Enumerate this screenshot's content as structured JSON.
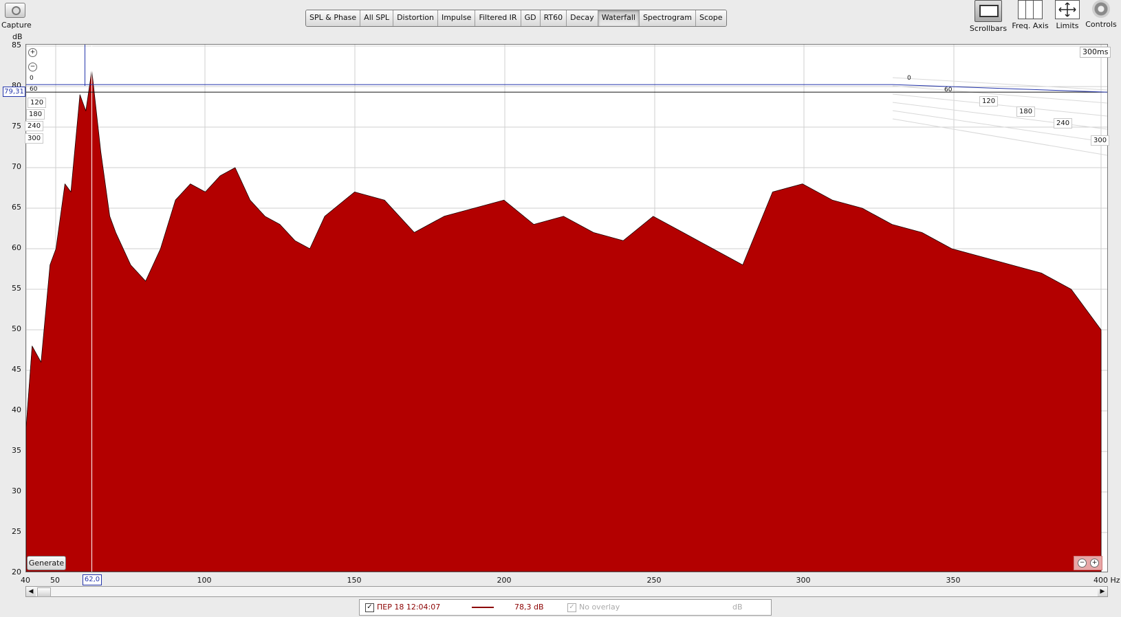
{
  "toolbar": {
    "capture_label": "Capture",
    "tabs": [
      "SPL & Phase",
      "All SPL",
      "Distortion",
      "Impulse",
      "Filtered IR",
      "GD",
      "RT60",
      "Decay",
      "Waterfall",
      "Spectrogram",
      "Scope"
    ],
    "active_tab": "Waterfall",
    "scrollbars_label": "Scrollbars",
    "freq_axis_label": "Freq. Axis",
    "limits_label": "Limits",
    "controls_label": "Controls"
  },
  "graph": {
    "y_unit": "dB",
    "x_unit": "Hz",
    "y_ticks": [
      "85",
      "80",
      "75",
      "70",
      "65",
      "60",
      "55",
      "50",
      "45",
      "40",
      "35",
      "30",
      "25",
      "20"
    ],
    "x_ticks": [
      "40",
      "50",
      "100",
      "150",
      "200",
      "250",
      "300",
      "350",
      "400 Hz"
    ],
    "cursor_y_readout": "79,31",
    "cursor_x_readout": "62,0",
    "time_depth_label": "300ms",
    "time_ticks_left": [
      "0",
      "60",
      "120",
      "180",
      "240",
      "300"
    ],
    "time_ticks_right": [
      "0",
      "60",
      "120",
      "180",
      "240",
      "300"
    ],
    "generate_button": "Generate",
    "fill_color": "#b30000",
    "line_color": "#1a0000"
  },
  "legend": {
    "measurement_name": "ПЕР 18 12:04:07",
    "measurement_level": "78,3 dB",
    "measurement_color": "#8b0000",
    "overlay_label": "No overlay",
    "overlay_unit": "dB"
  },
  "chart_data": {
    "type": "area",
    "title": "",
    "xlabel": "Hz",
    "ylabel": "dB",
    "xlim": [
      40,
      400
    ],
    "ylim": [
      20,
      85
    ],
    "time_axis_ms": [
      0,
      300
    ],
    "cursor": {
      "x": 62.0,
      "y": 79.31
    },
    "series": [
      {
        "x": [
          40,
          42,
          45,
          48,
          50,
          53,
          55,
          58,
          60,
          62,
          65,
          68,
          70,
          75,
          80,
          85,
          90,
          95,
          100,
          105,
          110,
          115,
          120,
          125,
          130,
          135,
          140,
          150,
          160,
          170,
          180,
          190,
          200,
          210,
          220,
          230,
          240,
          250,
          260,
          270,
          280,
          290,
          300,
          310,
          320,
          330,
          340,
          350,
          360,
          370,
          380,
          390,
          400
        ],
        "values": [
          38,
          48,
          46,
          58,
          60,
          68,
          67,
          79,
          77,
          82,
          72,
          64,
          62,
          58,
          56,
          60,
          66,
          68,
          67,
          69,
          70,
          66,
          64,
          63,
          61,
          60,
          64,
          67,
          66,
          62,
          64,
          65,
          66,
          63,
          64,
          62,
          61,
          64,
          62,
          60,
          58,
          67,
          68,
          66,
          65,
          63,
          62,
          60,
          59,
          58,
          57,
          55,
          50
        ]
      }
    ]
  }
}
